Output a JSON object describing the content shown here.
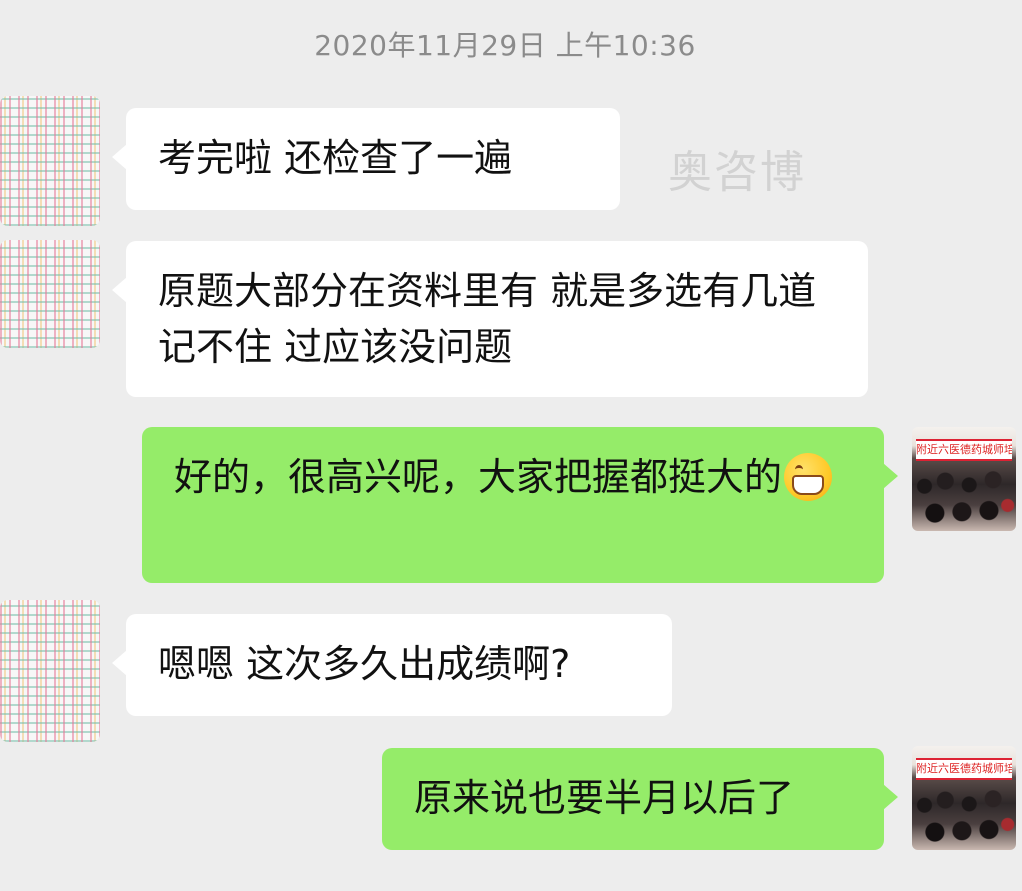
{
  "timestamp": "2020年11月29日 上午10:36",
  "watermark": "奥咨博",
  "messages": [
    {
      "side": "left",
      "text": "考完啦  还检查了一遍"
    },
    {
      "side": "left",
      "text": "原题大部分在资料里有 就是多选有几道记不住 过应该没问题"
    },
    {
      "side": "right",
      "text": "好的，很高兴呢，大家把握都挺大的",
      "emoji": "grin-emoji"
    },
    {
      "side": "left",
      "text": "嗯嗯  这次多久出成绩啊?"
    },
    {
      "side": "right",
      "text": "原来说也要半月以后了"
    }
  ],
  "my_avatar_banner": "附近六医德药城师培训",
  "colors": {
    "background": "#ededed",
    "incoming_bubble": "#ffffff",
    "outgoing_bubble": "#95ec69",
    "timestamp": "#8b8b8b"
  }
}
